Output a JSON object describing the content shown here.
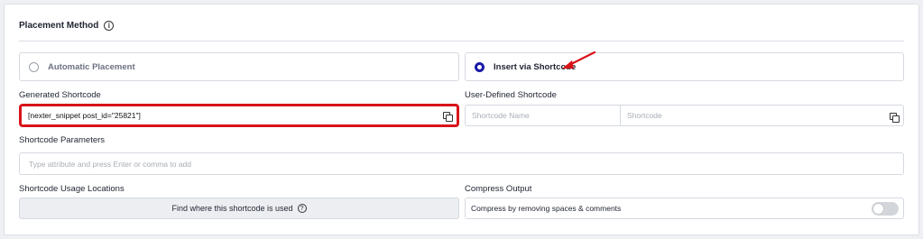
{
  "placement": {
    "title": "Placement Method",
    "info_icon": "info-icon",
    "options": [
      {
        "label": "Automatic Placement",
        "selected": false
      },
      {
        "label": "Insert via Shortcode",
        "selected": true
      }
    ]
  },
  "generated": {
    "label": "Generated Shortcode",
    "value": "[nexter_snippet post_id=\"25821\"]",
    "copy_icon": "copy-icon"
  },
  "user_defined": {
    "label": "User-Defined Shortcode",
    "name_placeholder": "Shortcode Name",
    "code_placeholder": "Shortcode",
    "copy_icon": "copy-icon"
  },
  "parameters": {
    "label": "Shortcode Parameters",
    "placeholder": "Type attribute and press Enter or comma to add"
  },
  "usage": {
    "label": "Shortcode Usage Locations",
    "button_label": "Find where this shortcode is used",
    "help_icon": "help-icon"
  },
  "compress": {
    "label": "Compress Output",
    "option_label": "Compress by removing spaces & comments",
    "enabled": false
  },
  "colors": {
    "highlight_border": "#d8141a",
    "radio_selected": "#1a1aa8",
    "arrow": "#d8141a"
  }
}
